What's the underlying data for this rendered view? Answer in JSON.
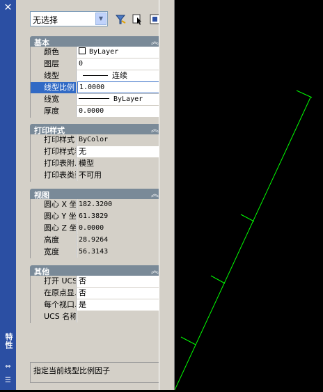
{
  "palette": {
    "title": "特性",
    "selection": "无选择",
    "description": "指定当前线型比例因子"
  },
  "sections": [
    {
      "title": "基本",
      "rows": [
        {
          "label": "颜色",
          "value": "ByLayer"
        },
        {
          "label": "图层",
          "value": "0"
        },
        {
          "label": "线型",
          "value": "连续"
        },
        {
          "label": "线型比例",
          "value": "1.0000"
        },
        {
          "label": "线宽",
          "value": "ByLayer"
        },
        {
          "label": "厚度",
          "value": "0.0000"
        }
      ]
    },
    {
      "title": "打印样式",
      "rows": [
        {
          "label": "打印样式",
          "value": "ByColor"
        },
        {
          "label": "打印样式表",
          "value": "无"
        },
        {
          "label": "打印表附...",
          "value": "模型"
        },
        {
          "label": "打印表类型",
          "value": "不可用"
        }
      ]
    },
    {
      "title": "视图",
      "rows": [
        {
          "label": "圆心 X 坐标",
          "value": "182.3200"
        },
        {
          "label": "圆心 Y 坐标",
          "value": "61.3829"
        },
        {
          "label": "圆心 Z 坐标",
          "value": "0.0000"
        },
        {
          "label": "高度",
          "value": "28.9264"
        },
        {
          "label": "宽度",
          "value": "56.3143"
        }
      ]
    },
    {
      "title": "其他",
      "rows": [
        {
          "label": "打开 UCS...",
          "value": "否"
        },
        {
          "label": "在原点显...",
          "value": "否"
        },
        {
          "label": "每个视口...",
          "value": "是"
        },
        {
          "label": "UCS 名称",
          "value": ""
        }
      ]
    }
  ],
  "colors": {
    "title_bar": "#2b4fa3",
    "panel_header": "#7a8a98",
    "selected_row": "#316ac5",
    "drawing_line": "#00ff00",
    "model_background": "#000000"
  }
}
